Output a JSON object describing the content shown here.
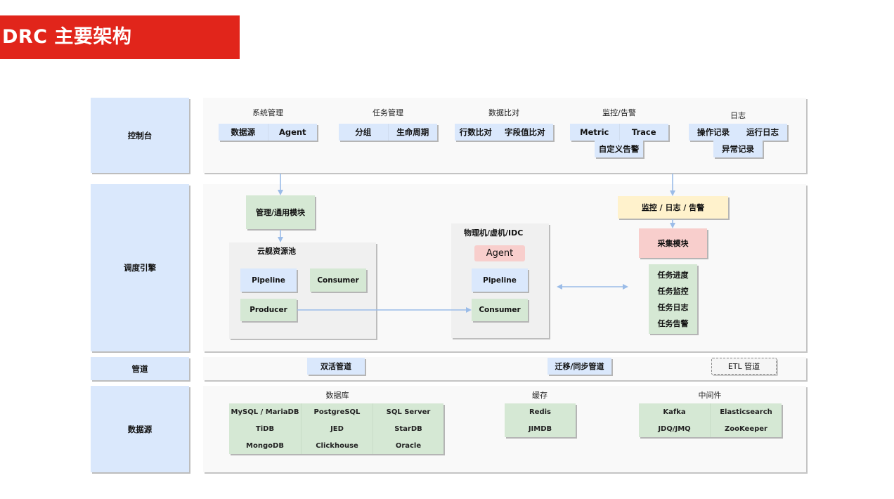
{
  "title": "DRC 主要架构",
  "colors": {
    "title_bar": "#e1251b",
    "layer_label": "#dae8fc",
    "blue": "#dae8fc",
    "green": "#d5e8d4",
    "yellow": "#fff2cc",
    "pink": "#f8cecc",
    "arrow": "#9bbce8"
  },
  "layers": {
    "console": "控制台",
    "scheduler": "调度引擎",
    "pipeline": "管道",
    "datasource": "数据源"
  },
  "console": {
    "groups": [
      {
        "title": "系统管理",
        "items": [
          "数据源",
          "Agent"
        ]
      },
      {
        "title": "任务管理",
        "items": [
          "分组",
          "生命周期"
        ]
      },
      {
        "title": "数据比对",
        "items": [
          "行数比对",
          "字段值比对"
        ]
      },
      {
        "title": "监控/告警",
        "items": [
          "Metric",
          "Trace"
        ],
        "extra": "自定义告警"
      },
      {
        "title": "日志",
        "items": [
          "操作记录",
          "运行日志"
        ],
        "extra": "异常记录"
      }
    ]
  },
  "scheduler": {
    "mgmt_module": "管理/通用模块",
    "cloud_pool": {
      "title": "云舰资源池",
      "pipeline": "Pipeline",
      "consumer": "Consumer",
      "producer": "Producer"
    },
    "physical": {
      "title": "物理机/虚机/IDC",
      "agent": "Agent",
      "pipeline": "Pipeline",
      "consumer": "Consumer"
    },
    "monitor": "监控 / 日志 / 告警",
    "collector": "采集模块",
    "task_items": [
      "任务进度",
      "任务监控",
      "任务日志",
      "任务告警"
    ]
  },
  "pipelines": {
    "active_active": "双活管道",
    "migration_sync": "迁移/同步管道",
    "etl": "ETL 管道"
  },
  "datasource": {
    "database": {
      "title": "数据库",
      "rows": [
        [
          "MySQL / MariaDB",
          "PostgreSQL",
          "SQL Server"
        ],
        [
          "TiDB",
          "JED",
          "StarDB"
        ],
        [
          "MongoDB",
          "Clickhouse",
          "Oracle"
        ]
      ]
    },
    "cache": {
      "title": "缓存",
      "rows": [
        [
          "Redis"
        ],
        [
          "JIMDB"
        ]
      ]
    },
    "middleware": {
      "title": "中间件",
      "rows": [
        [
          "Kafka",
          "Elasticsearch"
        ],
        [
          "JDQ/JMQ",
          "ZooKeeper"
        ]
      ]
    }
  }
}
